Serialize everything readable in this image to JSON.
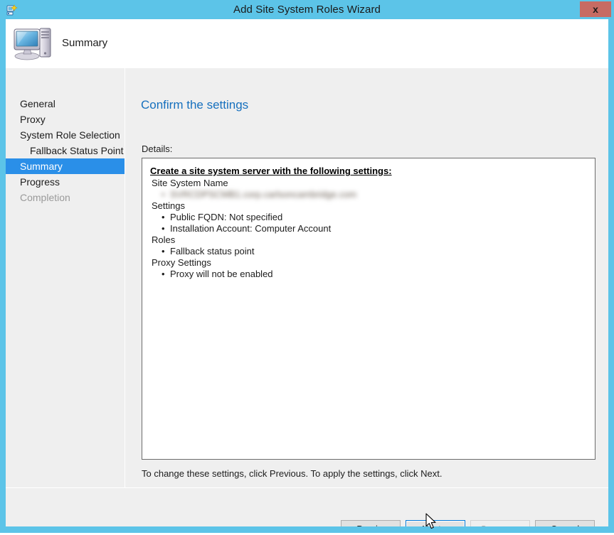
{
  "window": {
    "title": "Add Site System Roles Wizard",
    "title_icon": "wizard-icon",
    "close_label": "x",
    "frame_color": "#5CC4E8",
    "close_button_color": "#C76B63"
  },
  "header": {
    "icon": "computer-icon",
    "title": "Summary"
  },
  "sidebar": {
    "items": [
      {
        "label": "General",
        "state": "normal",
        "sub": false
      },
      {
        "label": "Proxy",
        "state": "normal",
        "sub": false
      },
      {
        "label": "System Role Selection",
        "state": "normal",
        "sub": false
      },
      {
        "label": "Fallback Status Point",
        "state": "normal",
        "sub": true
      },
      {
        "label": "Summary",
        "state": "selected",
        "sub": false
      },
      {
        "label": "Progress",
        "state": "normal",
        "sub": false
      },
      {
        "label": "Completion",
        "state": "disabled",
        "sub": false
      }
    ],
    "selected_color": "#2A8FE8"
  },
  "main": {
    "heading": "Confirm the settings",
    "heading_color": "#1670BE",
    "details_label": "Details:",
    "details": {
      "heading": "Create a site system server with the following settings:",
      "lines": [
        {
          "type": "group",
          "text": "Site System Name"
        },
        {
          "type": "bullet",
          "text": "SVRCDPSCMB1.corp.carlsoncambridge.com",
          "redacted": true
        },
        {
          "type": "group",
          "text": "Settings"
        },
        {
          "type": "bullet",
          "text": "Public FQDN: Not specified"
        },
        {
          "type": "bullet",
          "text": "Installation Account: Computer Account"
        },
        {
          "type": "group",
          "text": "Roles"
        },
        {
          "type": "bullet",
          "text": "Fallback status point"
        },
        {
          "type": "group",
          "text": "Proxy Settings"
        },
        {
          "type": "bullet",
          "text": "Proxy will not be enabled"
        }
      ]
    },
    "hint": "To change these settings, click Previous. To apply the settings, click Next."
  },
  "buttons": {
    "previous": "< Previous",
    "next": "Next >",
    "summary": "Summary",
    "cancel": "Cancel"
  }
}
